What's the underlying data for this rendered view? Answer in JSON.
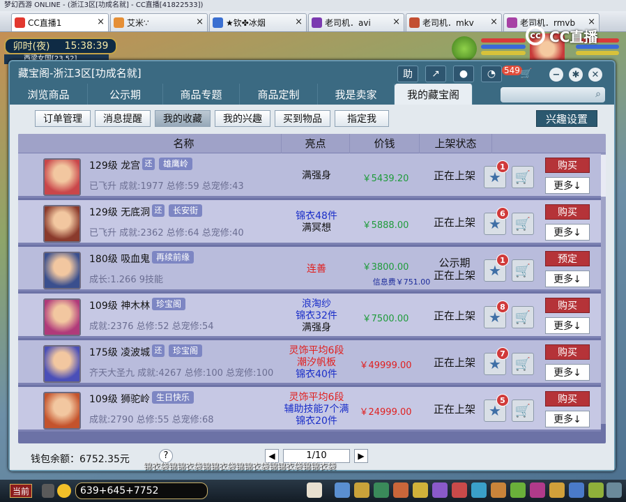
{
  "browser": {
    "title": "梦幻西游 ONLINE - (浙江3区[功成名就] - CC直播[41822533])",
    "tabs": [
      {
        "label": "CC直播1",
        "active": true,
        "color": "#e2382f"
      },
      {
        "label": "艾米∵",
        "active": false,
        "color": "#e58f36"
      },
      {
        "label": "★钦✤冰烟",
        "active": false,
        "color": "#3a6fd1"
      },
      {
        "label": "老司机．avi",
        "active": false,
        "color": "#7b3ab0"
      },
      {
        "label": "老司机．mkv",
        "active": false,
        "color": "#c34f32"
      },
      {
        "label": "老司机．rmvb",
        "active": false,
        "color": "#a742a5"
      }
    ],
    "close_glyph": "×"
  },
  "hud": {
    "time_of_day": "卯时(夜)",
    "clock": "15:38:39",
    "location": "西梁女国[23,52]",
    "cc_logo_text": "CC直播",
    "cc_logo_ring": "cc"
  },
  "window": {
    "title": "藏宝阁-浙江3区[功成名就]",
    "toolbar": {
      "help": "助",
      "unread_count": "549"
    },
    "nav_tabs": [
      "浏览商品",
      "公示期",
      "商品专题",
      "商品定制",
      "我是卖家",
      "我的藏宝阁"
    ],
    "active_nav": "我的藏宝阁",
    "search": {
      "placeholder": ""
    },
    "sub_buttons": [
      "订单管理",
      "消息提醒",
      "我的收藏",
      "我的兴趣",
      "买到物品",
      "指定我"
    ],
    "active_sub": "我的收藏",
    "interest_button": "兴趣设置",
    "columns": [
      "名称",
      "亮点",
      "价钱",
      "上架状态"
    ],
    "more_label": "更多↓",
    "rows": [
      {
        "level": "129级",
        "school": "龙宫",
        "tag_small": "还",
        "tag": "雄鹰岭",
        "sub": "已飞升 成就:1977 总修:59 总宠修:43",
        "highlights": [
          {
            "text": "满强身",
            "color": "#111111"
          }
        ],
        "price": "￥5439.20",
        "price_color": "#1e9b3a",
        "info_fee": "",
        "status": [
          "正在上架"
        ],
        "fav_count": "1",
        "action": "购买",
        "avatar_color": "#c9464a"
      },
      {
        "level": "129级",
        "school": "无底洞",
        "tag_small": "还",
        "tag": "长安街",
        "sub": "已飞升 成就:2362 总修:64 总宠修:40",
        "highlights": [
          {
            "text": "锦衣48件",
            "color": "#1a2ec8"
          },
          {
            "text": "满冥想",
            "color": "#111111"
          }
        ],
        "price": "￥5888.00",
        "price_color": "#1e9b3a",
        "info_fee": "",
        "status": [
          "正在上架"
        ],
        "fav_count": "6",
        "action": "购买",
        "avatar_color": "#8a3a2c"
      },
      {
        "level": "180级",
        "school": "吸血鬼",
        "tag_small": "",
        "tag": "再续前缘",
        "sub": "成长:1.266 9技能",
        "highlights": [
          {
            "text": "连善",
            "color": "#e0201f"
          }
        ],
        "price": "￥3800.00",
        "price_color": "#1e9b3a",
        "info_fee": "信息费￥751.00",
        "status": [
          "公示期",
          "正在上架"
        ],
        "fav_count": "1",
        "action": "预定",
        "avatar_color": "#3a4f8e"
      },
      {
        "level": "109级",
        "school": "神木林",
        "tag_small": "",
        "tag": "珍宝阁",
        "sub": "成就:2376 总修:52 总宠修:54",
        "highlights": [
          {
            "text": "浪淘纱",
            "color": "#1a2ec8"
          },
          {
            "text": "锦衣32件",
            "color": "#1a2ec8"
          },
          {
            "text": "满强身",
            "color": "#111111"
          }
        ],
        "price": "￥7500.00",
        "price_color": "#1e9b3a",
        "info_fee": "",
        "status": [
          "正在上架"
        ],
        "fav_count": "8",
        "action": "购买",
        "avatar_color": "#b03a7a"
      },
      {
        "level": "175级",
        "school": "凌波城",
        "tag_small": "还",
        "tag": "珍宝阁",
        "sub": "齐天大圣九 成就:4267 总修:100 总宠修:100",
        "highlights": [
          {
            "text": "灵饰平均6段",
            "color": "#e0201f"
          },
          {
            "text": "潮汐帆板",
            "color": "#e0201f"
          },
          {
            "text": "锦衣40件",
            "color": "#1a2ec8"
          }
        ],
        "price": "￥49999.00",
        "price_color": "#e0201f",
        "info_fee": "",
        "status": [
          "正在上架"
        ],
        "fav_count": "7",
        "action": "购买",
        "avatar_color": "#4a4fb8"
      },
      {
        "level": "109级",
        "school": "狮驼岭",
        "tag_small": "",
        "tag": "生日快乐",
        "sub": "成就:2790 总修:55 总宠修:68",
        "highlights": [
          {
            "text": "灵饰平均6段",
            "color": "#e0201f"
          },
          {
            "text": "辅助技能7个满",
            "color": "#1a2ec8"
          },
          {
            "text": "锦衣20件",
            "color": "#1a2ec8"
          }
        ],
        "price": "￥24999.00",
        "price_color": "#e0201f",
        "info_fee": "",
        "status": [
          "正在上架"
        ],
        "fav_count": "5",
        "action": "购买",
        "avatar_color": "#c4532c"
      }
    ],
    "footer": {
      "wallet": "钱包余额：6752.35元",
      "help": "?",
      "page": "1/10",
      "prev": "◀",
      "next": "▶"
    }
  },
  "bottom": {
    "overlay_text": "锦衣袋锦锦衣袋锦锦衣袋锦锦衣袋锦锦衣袋锦锦衣袋",
    "channel": "当前",
    "chat_input": "639+645+7752"
  }
}
